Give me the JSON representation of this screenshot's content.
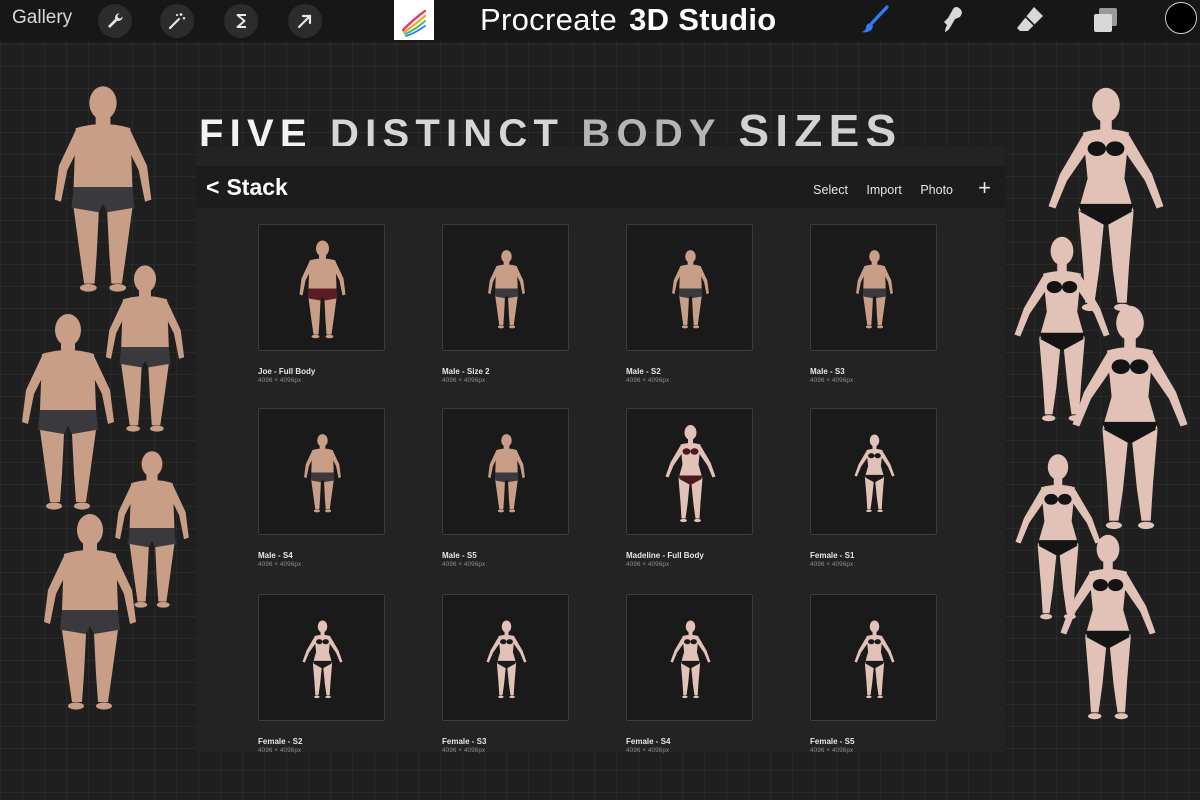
{
  "topbar": {
    "gallery_label": "Gallery",
    "title_light": "Procreate",
    "title_bold": "3D Studio",
    "left_tools": [
      "wrench-icon",
      "magic-wand-icon",
      "selection-s-icon",
      "move-arrow-icon"
    ],
    "right_tools": [
      "brush-icon",
      "smudge-icon",
      "eraser-icon",
      "layers-icon"
    ],
    "active_tool": "brush-icon",
    "accent_color": "#2f7df6",
    "current_color": "#000000"
  },
  "headline": {
    "words": [
      "FIVE",
      "DISTINCT",
      "BODY",
      "SIZES"
    ]
  },
  "stack": {
    "back_label": "Stack",
    "actions": [
      "Select",
      "Import",
      "Photo"
    ],
    "add_label": "+",
    "items": [
      {
        "name": "Joe - Full Body",
        "size": "4096 × 4096px",
        "figure": "male",
        "underwear_color": "#5a1e22"
      },
      {
        "name": "Male - Size 2",
        "size": "4096 × 4096px",
        "figure": "male",
        "underwear_color": "#3a3a3e"
      },
      {
        "name": "Male - S2",
        "size": "4096 × 4096px",
        "figure": "male",
        "underwear_color": "#3a3a3e"
      },
      {
        "name": "Male - S3",
        "size": "4096 × 4096px",
        "figure": "male",
        "underwear_color": "#3a3a3e"
      },
      {
        "name": "Male - S4",
        "size": "4096 × 4096px",
        "figure": "male",
        "underwear_color": "#3a3a3e"
      },
      {
        "name": "Male - S5",
        "size": "4096 × 4096px",
        "figure": "male",
        "underwear_color": "#3a3a3e"
      },
      {
        "name": "Madeline - Full Body",
        "size": "4096 × 4096px",
        "figure": "female",
        "underwear_color": "#4a1a1e"
      },
      {
        "name": "Female - S1",
        "size": "4096 × 4096px",
        "figure": "female",
        "underwear_color": "#1a1a1a"
      },
      {
        "name": "Female - S2",
        "size": "4096 × 4096px",
        "figure": "female",
        "underwear_color": "#1a1a1a"
      },
      {
        "name": "Female - S3",
        "size": "4096 × 4096px",
        "figure": "female",
        "underwear_color": "#1a1a1a"
      },
      {
        "name": "Female - S4",
        "size": "4096 × 4096px",
        "figure": "female",
        "underwear_color": "#1a1a1a"
      },
      {
        "name": "Female - S5",
        "size": "4096 × 4096px",
        "figure": "female",
        "underwear_color": "#1a1a1a"
      }
    ]
  },
  "colors": {
    "male_skin": "#c99e86",
    "female_skin": "#e2c2b7",
    "male_underwear": "#3a3a3e",
    "female_underwear": "#141414"
  }
}
